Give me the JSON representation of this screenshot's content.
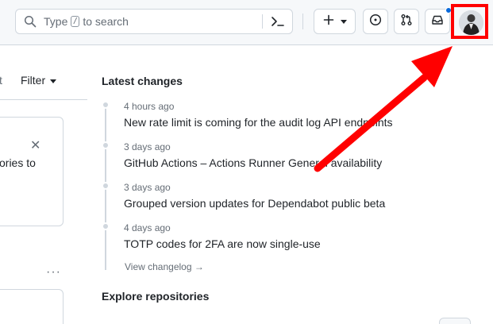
{
  "header": {
    "search": {
      "prefix": "Type",
      "key": "/",
      "suffix": "to search"
    },
    "icons": {
      "search": "search-icon",
      "command_palette": "command-palette-icon",
      "create": "plus-icon",
      "create_dropdown": "triangle-down-icon",
      "issues": "issue-opened-icon",
      "pull_requests": "git-pull-request-icon",
      "inbox": "inbox-icon",
      "avatar": "user-avatar"
    },
    "unread_indicator_color": "#0969da",
    "avatar_highlight_color": "#ff0000"
  },
  "left": {
    "truncated_label": "t",
    "filter_label": "Filter",
    "card_close": "✕",
    "card_text": "ories to",
    "more_menu": "···"
  },
  "feed": {
    "latest_title": "Latest changes",
    "entries": [
      {
        "time": "4 hours ago",
        "title": "New rate limit is coming for the audit log API endpoints"
      },
      {
        "time": "3 days ago",
        "title": "GitHub Actions – Actions Runner General availability"
      },
      {
        "time": "3 days ago",
        "title": "Grouped version updates for Dependabot public beta"
      },
      {
        "time": "4 days ago",
        "title": "TOTP codes for 2FA are now single-use"
      }
    ],
    "changelog_link": "View changelog →",
    "explore_title": "Explore repositories"
  },
  "annotation": {
    "color": "#ff0000",
    "shape": "arrow pointing to avatar"
  }
}
